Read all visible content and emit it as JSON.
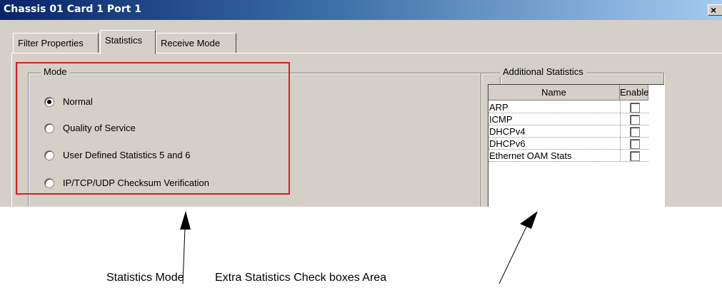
{
  "window": {
    "title": "Chassis 01 Card 1 Port 1",
    "close_label": "×"
  },
  "tabs": [
    "Filter Properties",
    "Statistics",
    "Receive Mode"
  ],
  "active_tab": "Statistics",
  "mode_group": {
    "label": "Mode",
    "options": [
      {
        "label": "Normal",
        "selected": true
      },
      {
        "label": "Quality of Service",
        "selected": false
      },
      {
        "label": "User Defined Statistics 5 and 6",
        "selected": false
      },
      {
        "label": "IP/TCP/UDP Checksum Verification",
        "selected": false
      }
    ]
  },
  "additional_group": {
    "label": "Additional Statistics",
    "columns": [
      "Name",
      "Enable"
    ],
    "rows": [
      {
        "name": "ARP",
        "enabled": false
      },
      {
        "name": "ICMP",
        "enabled": false
      },
      {
        "name": "DHCPv4",
        "enabled": false
      },
      {
        "name": "DHCPv6",
        "enabled": false
      },
      {
        "name": "Ethernet OAM Stats",
        "enabled": false
      }
    ]
  },
  "annotations": {
    "statistics_mode": "Statistics Mode",
    "extra_area": "Extra Statistics Check boxes Area",
    "highlight_color": "#e31a1a"
  }
}
